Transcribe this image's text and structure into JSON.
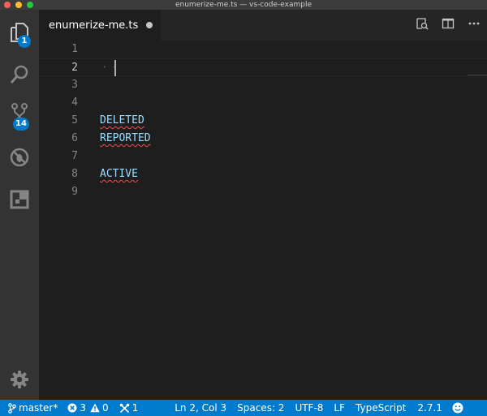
{
  "window": {
    "title": "enumerize-me.ts — vs-code-example"
  },
  "activity_bar": {
    "explorer_badge": "1",
    "scm_badge": "14"
  },
  "tab": {
    "label": "enumerize-me.ts"
  },
  "editor": {
    "line_numbers": [
      "1",
      "2",
      "3",
      "4",
      "5",
      "6",
      "7",
      "8",
      "9"
    ],
    "lines": [
      "",
      "··",
      "",
      "",
      "DELETED",
      "REPORTED",
      "",
      "ACTIVE",
      ""
    ]
  },
  "status_bar": {
    "branch": "master*",
    "errors": "3",
    "warnings": "0",
    "tasks": "1",
    "position": "Ln 2, Col 3",
    "indentation": "Spaces: 2",
    "encoding": "UTF-8",
    "eol": "LF",
    "language": "TypeScript",
    "version": "2.7.1"
  },
  "colors": {
    "accent": "#007acc",
    "identifier": "#9cdcfe",
    "error_squiggle": "#f14c4c"
  },
  "icons": [
    "files-icon",
    "search-icon",
    "source-control-icon",
    "debug-icon",
    "extensions-icon",
    "settings-gear-icon",
    "open-preview-icon",
    "split-editor-icon",
    "more-icon",
    "git-branch-icon",
    "error-icon",
    "warning-icon",
    "tools-icon",
    "smiley-icon"
  ]
}
